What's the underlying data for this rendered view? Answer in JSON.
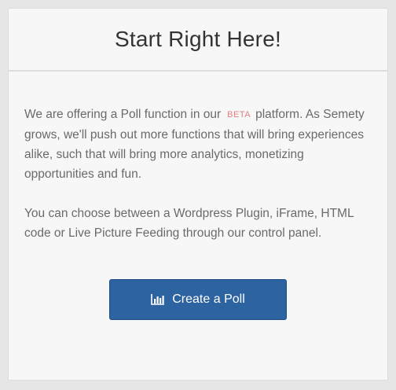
{
  "header": {
    "title": "Start Right Here!"
  },
  "body": {
    "para1_before": "We are offering a Poll function in our",
    "beta_badge": "BETA",
    "para1_after": "platform. As Semety grows, we'll push out more functions that will bring experiences alike, such that will bring more analytics, monetizing opportunities and fun.",
    "para2": "You can choose between a Wordpress Plugin, iFrame, HTML code or Live Picture Feeding through our control panel."
  },
  "cta": {
    "label": "Create a Poll",
    "icon": "bar-chart-icon"
  },
  "colors": {
    "button": "#2e63a1",
    "beta": "#e57d7d",
    "text": "#6a6a6a",
    "title": "#333333"
  }
}
